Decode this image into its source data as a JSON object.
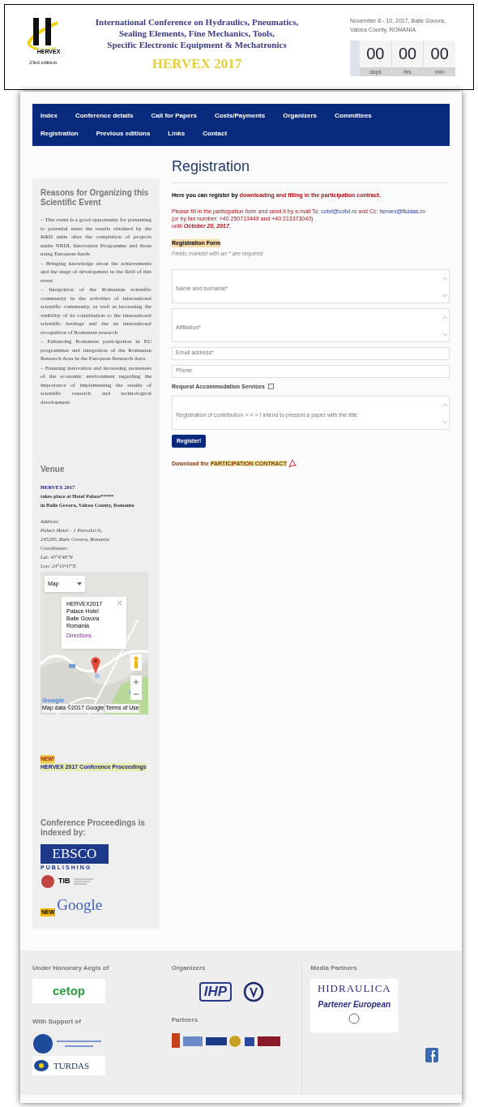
{
  "header": {
    "logo_text": "HERVEX",
    "edition": "23rd edition",
    "title_lines": [
      "International Conference on Hydraulics, Pneumatics,",
      "Sealing Elements, Fine Mechanics, Tools,",
      "Specific Electronic Equipment & Mechatronics"
    ],
    "event": "HERVEX 2017",
    "date_lines": [
      "November 8 - 10, 2017, Baile Govora,",
      "Valcea County, ROMANIA"
    ],
    "countdown": [
      {
        "value": "00",
        "unit": "days"
      },
      {
        "value": "00",
        "unit": "hrs"
      },
      {
        "value": "00",
        "unit": "min"
      }
    ]
  },
  "nav": {
    "rows": [
      [
        "Index",
        "Conference details",
        "Call for Papers",
        "Costs/Payments",
        "Organizers",
        "Committees"
      ],
      [
        "Registration",
        "Previous editions",
        "Links",
        "Contact"
      ]
    ]
  },
  "sidebar": {
    "reasons": {
      "title": "Reasons for Organizing this Scientific Event",
      "items": [
        "– This event is a good opportunity for presenting to potential users the results obtained by the R&D units after the completion of projects under NRDI, Innovation Programme and those using European funds",
        "– Bringing knowledge about the achievements and the stage of development in the field of this event",
        "– Integration of the Romanian scientific community in the activities of international scientific community, as well as increasing the visibility of its contribution to the international scientific heritage and the an international recognition of Romanian research",
        "– Enhancing Romanian participation in EU programmes and integration of the Romanian Research Area in the European Research Area",
        "– Ensuring innovation and increasing awareness of the economic environment regarding the importance of implementing the results of scientific research and technological development"
      ]
    },
    "venue": {
      "title": "Venue",
      "name": "HERVEX 2017",
      "lines": [
        "takes place at Hotel Palace*****",
        "in Baile Govora, Valcea County, Romania"
      ],
      "address_lines": [
        "Address:",
        "Palace Hotel – 1 Parcului St,",
        "245200, Baile Govora, Romania",
        "Coordinates:",
        "Lat: 45°4'48\"N",
        "Lon: 24°10'47\"E"
      ]
    },
    "map": {
      "type_label": "Map",
      "info_lines": [
        "HERVEX2017",
        "Palace Hotel",
        "Baile Govora",
        "Romania"
      ],
      "info_link": "Directions",
      "logo": "Google",
      "attribution": "Map data ©2017 Google",
      "terms": "Terms of Use"
    },
    "news": {
      "badge": "NEW!",
      "link": "HERVEX 2017 Conference Proceedings"
    },
    "indexed": {
      "title": "Conference Proceedings is indexed by:",
      "ebsco": "EBSCO",
      "ebsco_sub": "PUBLISHING",
      "tib": "TIB",
      "google": "Google",
      "google_badge": "NEW"
    }
  },
  "main": {
    "title": "Registration",
    "intro_lead": "Here you can register by",
    "intro_link": "downloading and filling in the participation contract.",
    "instructions": {
      "lead": "Please fill in the participation form and send it by e-mail To:",
      "to": "cotvl@cotvl.ro",
      "mid": "and Cc:",
      "cc": "hervex@fluidas.ro",
      "fax": "(or by fax number: +40 250713449 and +40 213373040)",
      "until": "until",
      "deadline": "October 20, 2017."
    },
    "form": {
      "title": "Registration Form",
      "note": "Fields marked with an * are required",
      "fields": [
        {
          "kind": "textarea",
          "placeholder": "Name and surname*"
        },
        {
          "kind": "textarea",
          "placeholder": "Affiliation*"
        },
        {
          "kind": "input",
          "placeholder": "Email address*"
        },
        {
          "kind": "input",
          "placeholder": "Phone"
        },
        {
          "kind": "checkbox",
          "label": "Request Accommodation Services",
          "checked": false
        },
        {
          "kind": "textarea",
          "placeholder": "Registration of contribution > > > I intend to present a paper with the title:"
        }
      ],
      "button": "Register!"
    },
    "download_lead": "Download the",
    "download_link": "PARTICIPATION CONTRACT"
  },
  "footer": {
    "aegis_title": "Under Honorary Aegis of",
    "aegis_logo": "cetop",
    "support_title": "With Support of",
    "support_logo": "TURDAS",
    "organizers_title": "Organizers",
    "organizers_logo": "IHP",
    "partners_title": "Partners",
    "media_title": "Media Partners",
    "media_logo": "HIDRAULICA",
    "media_logo_sub": "Partener European"
  }
}
